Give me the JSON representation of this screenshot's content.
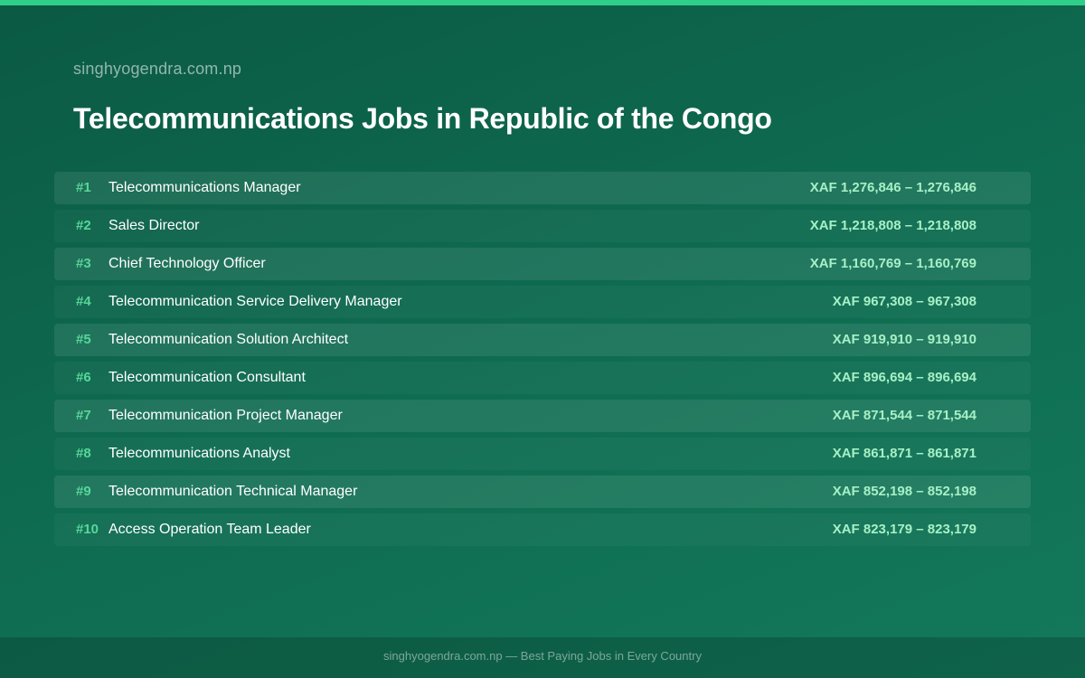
{
  "header": {
    "site": "singhyogendra.com.np",
    "title": "Telecommunications Jobs in Republic of the Congo"
  },
  "jobs": [
    {
      "rank": "#1",
      "title": "Telecommunications Manager",
      "salary": "XAF 1,276,846 – 1,276,846"
    },
    {
      "rank": "#2",
      "title": "Sales Director",
      "salary": "XAF 1,218,808 – 1,218,808"
    },
    {
      "rank": "#3",
      "title": "Chief Technology Officer",
      "salary": "XAF 1,160,769 – 1,160,769"
    },
    {
      "rank": "#4",
      "title": "Telecommunication Service Delivery Manager",
      "salary": "XAF 967,308 – 967,308"
    },
    {
      "rank": "#5",
      "title": "Telecommunication Solution Architect",
      "salary": "XAF 919,910 – 919,910"
    },
    {
      "rank": "#6",
      "title": "Telecommunication Consultant",
      "salary": "XAF 896,694 – 896,694"
    },
    {
      "rank": "#7",
      "title": "Telecommunication Project Manager",
      "salary": "XAF 871,544 – 871,544"
    },
    {
      "rank": "#8",
      "title": "Telecommunications Analyst",
      "salary": "XAF 861,871 – 861,871"
    },
    {
      "rank": "#9",
      "title": "Telecommunication Technical Manager",
      "salary": "XAF 852,198 – 852,198"
    },
    {
      "rank": "#10",
      "title": "Access Operation Team Leader",
      "salary": "XAF 823,179 – 823,179"
    }
  ],
  "footer": {
    "text": "singhyogendra.com.np — Best Paying Jobs in Every Country"
  },
  "colors": {
    "background": "#0e6a4f",
    "accent": "#2fcf8a",
    "rank": "#56d79a",
    "salary": "#a6f0c6"
  }
}
